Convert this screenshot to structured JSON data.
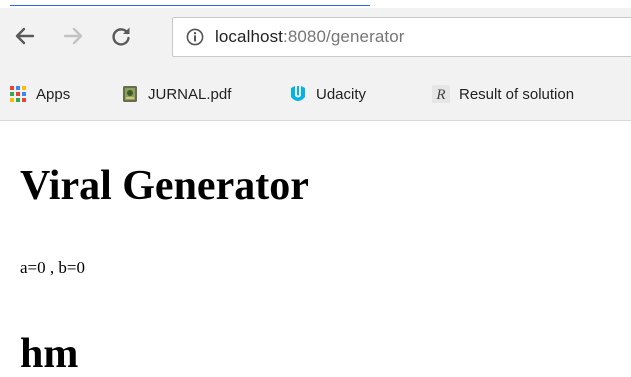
{
  "browser": {
    "url_host": "localhost",
    "url_rest": ":8080/generator",
    "bookmarks": [
      {
        "label": "Apps",
        "icon": "apps-grid-icon"
      },
      {
        "label": "JURNAL.pdf",
        "icon": "pdf-file-icon"
      },
      {
        "label": "Udacity",
        "icon": "udacity-logo-icon"
      },
      {
        "label": "Result of solution",
        "icon": "r-logo-icon"
      }
    ],
    "accent": "#2a6cd6"
  },
  "page": {
    "title": "Viral Generator",
    "values_text": "a=0 , b=0",
    "subheading": "hm"
  }
}
